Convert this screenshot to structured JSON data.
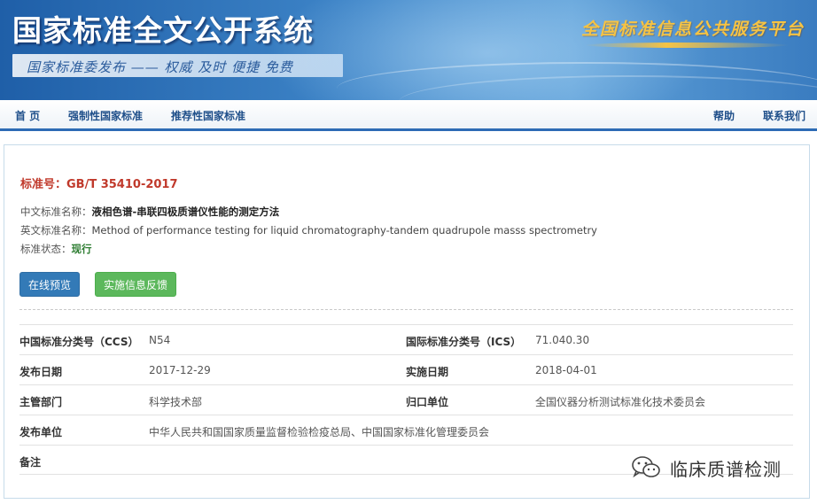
{
  "banner": {
    "site_title": "国家标准全文公开系统",
    "slogan": "国家标准委发布 —— 权威 及时 便捷 免费",
    "platform": "全国标准信息公共服务平台"
  },
  "nav": {
    "home": "首 页",
    "mandatory": "强制性国家标准",
    "recommended": "推荐性国家标准",
    "help": "帮助",
    "contact": "联系我们"
  },
  "standard": {
    "number": "标准号：GB/T 35410-2017",
    "cn_name_label": "中文标准名称：",
    "cn_name": "液相色谱-串联四极质谱仪性能的测定方法",
    "en_name_label": "英文标准名称：",
    "en_name": "Method of performance testing for liquid chromatography-tandem quadrupole masss spectrometry",
    "status_label": "标准状态：",
    "status": "现行"
  },
  "buttons": {
    "preview": "在线预览",
    "feedback": "实施信息反馈"
  },
  "details": {
    "ccs_label": "中国标准分类号（CCS）",
    "ccs": "N54",
    "ics_label": "国际标准分类号（ICS）",
    "ics": "71.040.30",
    "pub_date_label": "发布日期",
    "pub_date": "2017-12-29",
    "impl_date_label": "实施日期",
    "impl_date": "2018-04-01",
    "dept_label": "主管部门",
    "dept": "科学技术部",
    "tc_label": "归口单位",
    "tc": "全国仪器分析测试标准化技术委员会",
    "publisher_label": "发布单位",
    "publisher": "中华人民共和国国家质量监督检验检疫总局、中国国家标准化管理委员会",
    "remarks_label": "备注",
    "remarks": ""
  },
  "watermark": {
    "text": "临床质谱检测",
    "icon": "wechat-icon"
  },
  "colors": {
    "banner_blue": "#1f5fa8",
    "nav_text": "#1f4f8a",
    "std_number_red": "#c0392b",
    "status_green": "#2e7d32",
    "btn_blue": "#337ab7",
    "btn_green": "#5cb85c"
  }
}
